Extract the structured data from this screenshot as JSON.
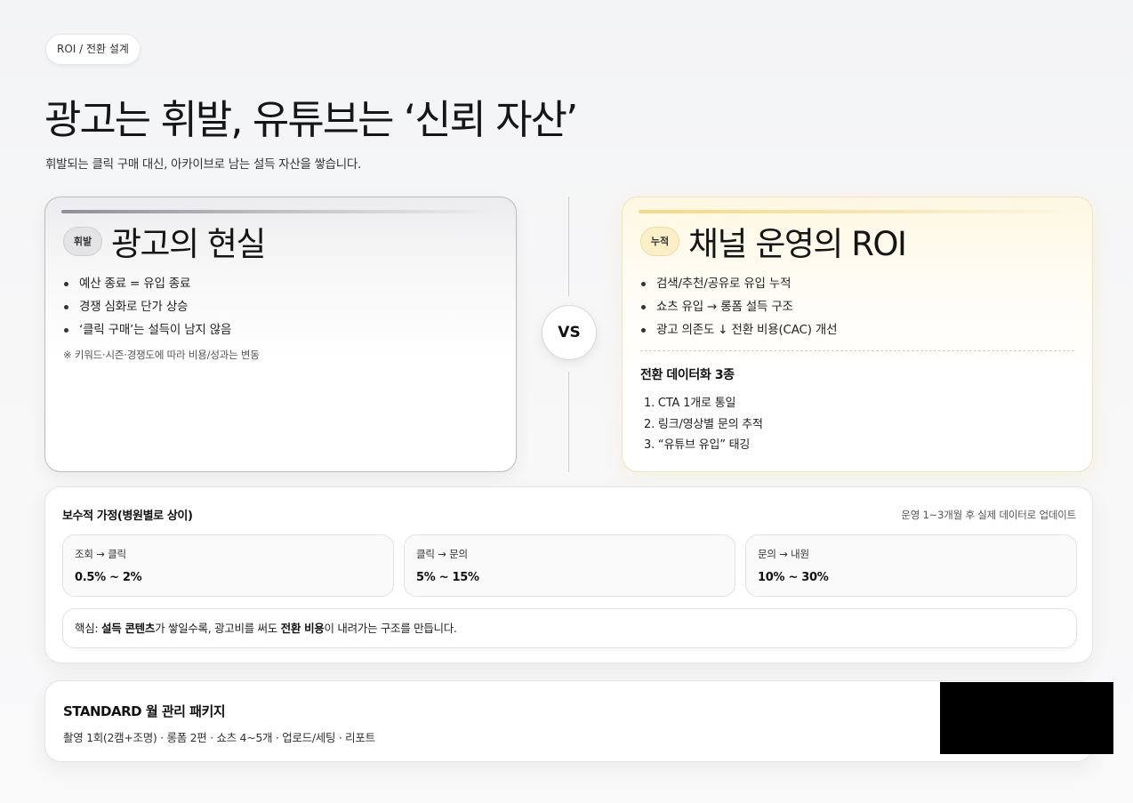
{
  "tag": "ROI / 전환 설계",
  "title": "광고는 휘발, 유튜브는 ‘신뢰 자산’",
  "subtitle": "휘발되는 클릭 구매 대신, 아카이브로 남는 설득 자산을 쌓습니다.",
  "left_card": {
    "badge": "휘발",
    "title": "광고의 현실",
    "bullets": [
      "예산 종료 = 유입 종료",
      "경쟁 심화로 단가 상승",
      "‘클릭 구매’는 설득이 남지 않음"
    ],
    "note": "※ 키워드·시즌·경쟁도에 따라 비용/성과는 변동"
  },
  "vs": "VS",
  "right_card": {
    "badge": "누적",
    "title": "채널 운영의 ROI",
    "bullets": [
      "검색/추천/공유로 유입 누적",
      "쇼츠 유입 → 롱폼 설득 구조",
      "광고 의존도 ↓ 전환 비용(CAC) 개선"
    ],
    "sub_title": "전환 데이터화 3종",
    "steps": [
      "1. CTA 1개로 통일",
      "2. 링크/영상별 문의 추적",
      "3. “유튜브 유입” 태깅"
    ]
  },
  "assumptions": {
    "title": "보수적 가정(병원별로 상이)",
    "meta": "운영 1~3개월 후 실제 데이터로 업데이트",
    "metrics": [
      {
        "label": "조회 → 클릭",
        "value": "0.5% ~ 2%"
      },
      {
        "label": "클릭 → 문의",
        "value": "5% ~ 15%"
      },
      {
        "label": "문의 → 내원",
        "value": "10% ~ 30%"
      }
    ],
    "core": {
      "prefix": "핵심: ",
      "bold1": "설득 콘텐츠",
      "mid": "가 쌓일수록, 광고비를 써도 ",
      "bold2": "전환 비용",
      "suffix": "이 내려가는 구조를 만듭니다."
    }
  },
  "package": {
    "title": "STANDARD 월 관리 패키지",
    "desc": "촬영 1회(2캠+조명) · 롱폼 2편 · 쇼츠 4~5개 · 업로드/세팅 · 리포트"
  }
}
